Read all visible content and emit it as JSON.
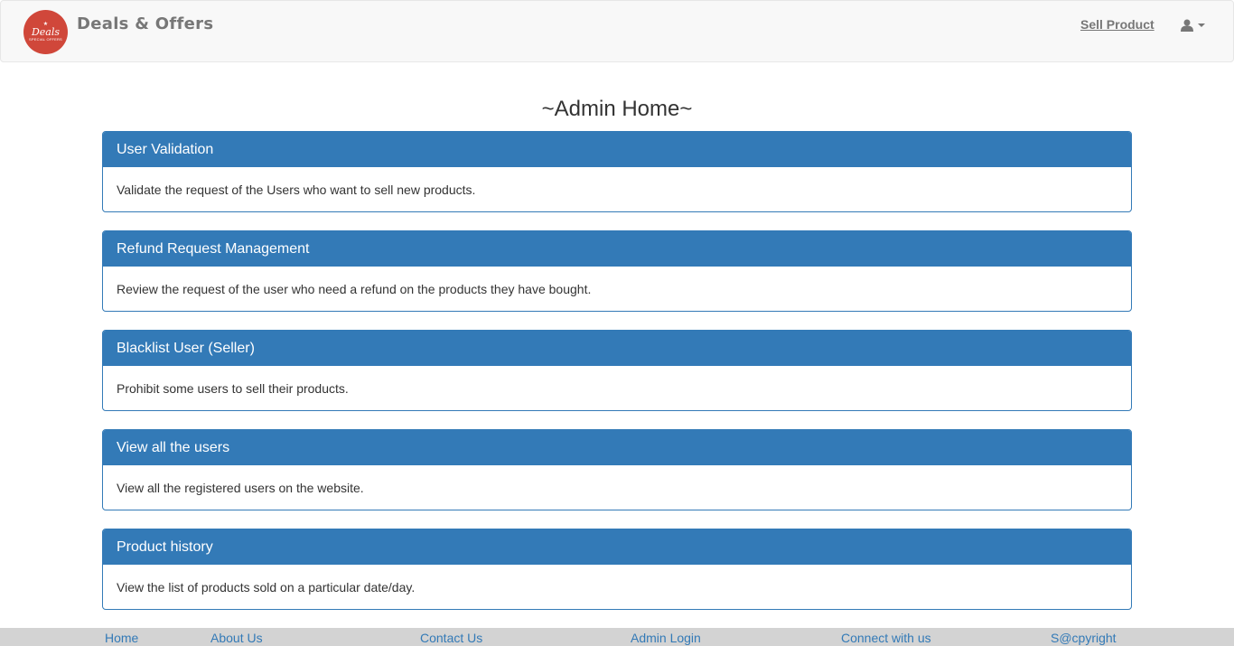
{
  "navbar": {
    "logo": {
      "line1": "Deals",
      "line2": "SPECIAL OFFERS",
      "icon": "deals-logo"
    },
    "brand": "Deals & Offers",
    "sell_link": "Sell Product",
    "user_icon": "user-icon",
    "caret_icon": "caret-down-icon"
  },
  "page": {
    "title": "~Admin Home~"
  },
  "panels": [
    {
      "heading": "User Validation",
      "body": "Validate the request of the Users who want to sell new products."
    },
    {
      "heading": "Refund Request Management",
      "body": "Review the request of the user who need a refund on the products they have bought."
    },
    {
      "heading": "Blacklist User (Seller)",
      "body": "Prohibit some users to sell their products."
    },
    {
      "heading": "View all the users",
      "body": "View all the registered users on the website."
    },
    {
      "heading": "Product history",
      "body": "View the list of products sold on a particular date/day."
    }
  ],
  "footer": {
    "links": [
      "Home",
      "About Us",
      "Contact Us",
      "Admin Login",
      "Connect with us",
      "S@cpyright"
    ]
  },
  "colors": {
    "primary": "#337ab7",
    "navbar_bg": "#f8f8f8",
    "footer_bg": "#d3d3d3",
    "logo_bg": "#d0473a"
  }
}
